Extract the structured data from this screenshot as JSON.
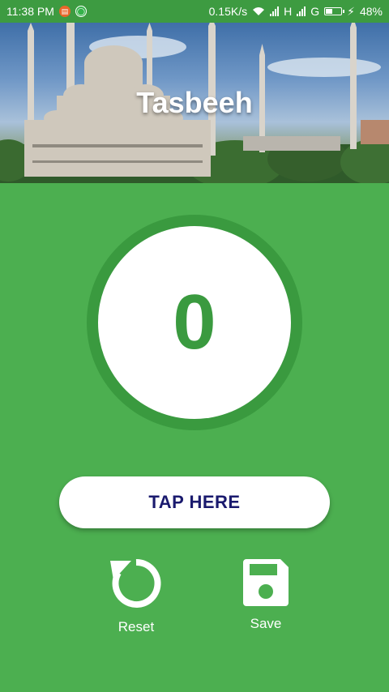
{
  "status_bar": {
    "time": "11:38 PM",
    "network_speed": "0.15K/s",
    "signal_h": "H",
    "signal_g": "G",
    "battery_percent": "48%",
    "battery_level": 0.48,
    "icons": [
      "notification-orange-icon",
      "notification-green-icon",
      "wifi-icon",
      "signal-icon",
      "battery-charging-icon"
    ]
  },
  "header": {
    "title": "Tasbeeh",
    "background": "mosque-photo"
  },
  "counter": {
    "value": "0",
    "ring_color": "#3a9a3f",
    "digit_color": "#3a9a3f"
  },
  "tap_button": {
    "label": "TAP HERE",
    "text_color": "#1a1a6e"
  },
  "actions": {
    "reset": {
      "label": "Reset",
      "icon": "reset-icon"
    },
    "save": {
      "label": "Save",
      "icon": "save-icon"
    }
  },
  "colors": {
    "background": "#4caf50",
    "status_bar": "#3d9b41"
  }
}
